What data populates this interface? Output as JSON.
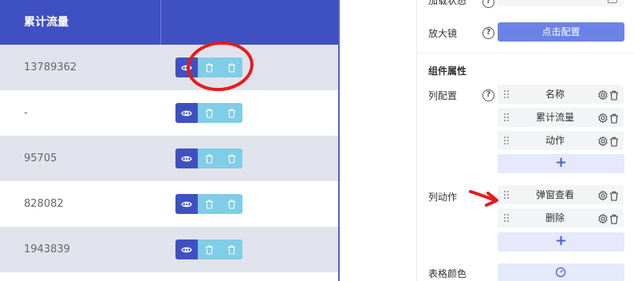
{
  "table": {
    "column_1_header": "累计流量",
    "rows": [
      {
        "value": "13789362",
        "shaded": true
      },
      {
        "value": "-",
        "shaded": false
      },
      {
        "value": "95705",
        "shaded": true
      },
      {
        "value": "828082",
        "shaded": false
      },
      {
        "value": "1943839",
        "shaded": true
      }
    ],
    "action_icons": [
      "eye-icon",
      "trash-icon",
      "trash-icon"
    ]
  },
  "panel": {
    "loading_state_label": "加载状态",
    "magnifier_label": "放大镜",
    "magnifier_button": "点击配置",
    "component_props_title": "组件属性",
    "column_config_label": "列配置",
    "column_items": [
      "名称",
      "累计流量",
      "动作"
    ],
    "column_actions_label": "列动作",
    "action_items": [
      "弹窗查看",
      "删除"
    ],
    "add_symbol": "+",
    "table_color_label": "表格颜色",
    "help_symbol": "?"
  },
  "colors": {
    "header_bg": "#3f51c2",
    "view_button": "#3f51c2",
    "delete_button": "#7fcde6",
    "primary_button": "#6b82e6",
    "annotation_red": "#e51c1c"
  }
}
